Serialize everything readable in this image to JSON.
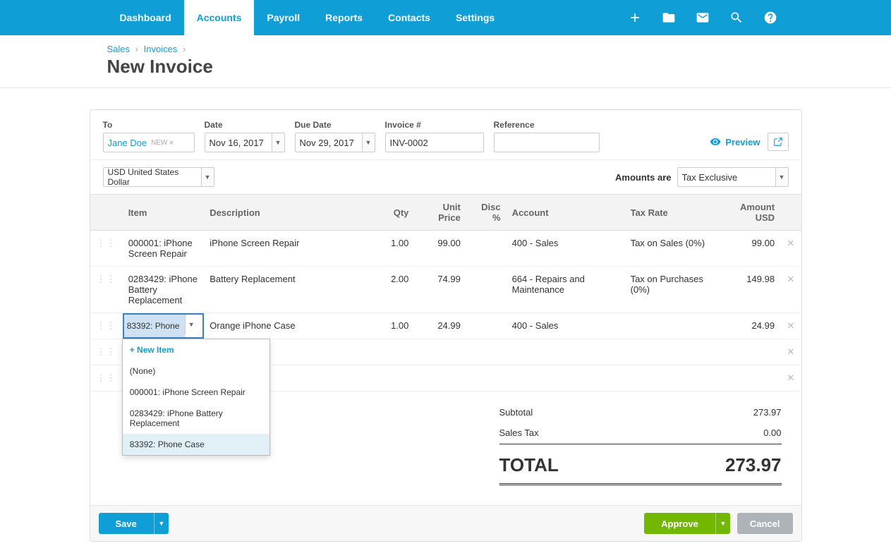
{
  "nav": {
    "items": [
      "Dashboard",
      "Accounts",
      "Payroll",
      "Reports",
      "Contacts",
      "Settings"
    ],
    "active_index": 1
  },
  "breadcrumb": {
    "sales": "Sales",
    "invoices": "Invoices"
  },
  "page_title": "New Invoice",
  "fields": {
    "to_label": "To",
    "to_value": "Jane Doe",
    "to_new_badge": "NEW",
    "date_label": "Date",
    "date_value": "Nov 16, 2017",
    "due_label": "Due Date",
    "due_value": "Nov 29, 2017",
    "invno_label": "Invoice #",
    "invno_value": "INV-0002",
    "ref_label": "Reference",
    "ref_value": ""
  },
  "preview_label": "Preview",
  "currency": "USD United States Dollar",
  "amounts_are_label": "Amounts are",
  "amounts_are_value": "Tax Exclusive",
  "columns": {
    "item": "Item",
    "description": "Description",
    "qty": "Qty",
    "unit_price": "Unit Price",
    "disc": "Disc %",
    "account": "Account",
    "tax": "Tax Rate",
    "amount": "Amount USD"
  },
  "rows": [
    {
      "item": "000001: iPhone Screen Repair",
      "description": "iPhone Screen Repair",
      "qty": "1.00",
      "unit_price": "99.00",
      "disc": "",
      "account": "400 - Sales",
      "tax": "Tax on Sales (0%)",
      "amount": "99.00"
    },
    {
      "item": "0283429: iPhone Battery Replacement",
      "description": "Battery Replacement",
      "qty": "2.00",
      "unit_price": "74.99",
      "disc": "",
      "account": "664 - Repairs and Maintenance",
      "tax": "Tax on Purchases (0%)",
      "amount": "149.98"
    },
    {
      "item_editing": "83392: Phone",
      "description": "Orange iPhone Case",
      "qty": "1.00",
      "unit_price": "24.99",
      "disc": "",
      "account": "400 - Sales",
      "tax": "",
      "amount": "24.99"
    }
  ],
  "dropdown": {
    "new_item": "+ New Item",
    "options": [
      "(None)",
      "000001: iPhone Screen Repair",
      "0283429: iPhone Battery Replacement",
      "83392: Phone Case"
    ],
    "highlighted_index": 3
  },
  "totals": {
    "subtotal_label": "Subtotal",
    "subtotal_value": "273.97",
    "tax_label": "Sales Tax",
    "tax_value": "0.00",
    "total_label": "TOTAL",
    "total_value": "273.97"
  },
  "footer": {
    "save": "Save",
    "approve": "Approve",
    "cancel": "Cancel"
  }
}
